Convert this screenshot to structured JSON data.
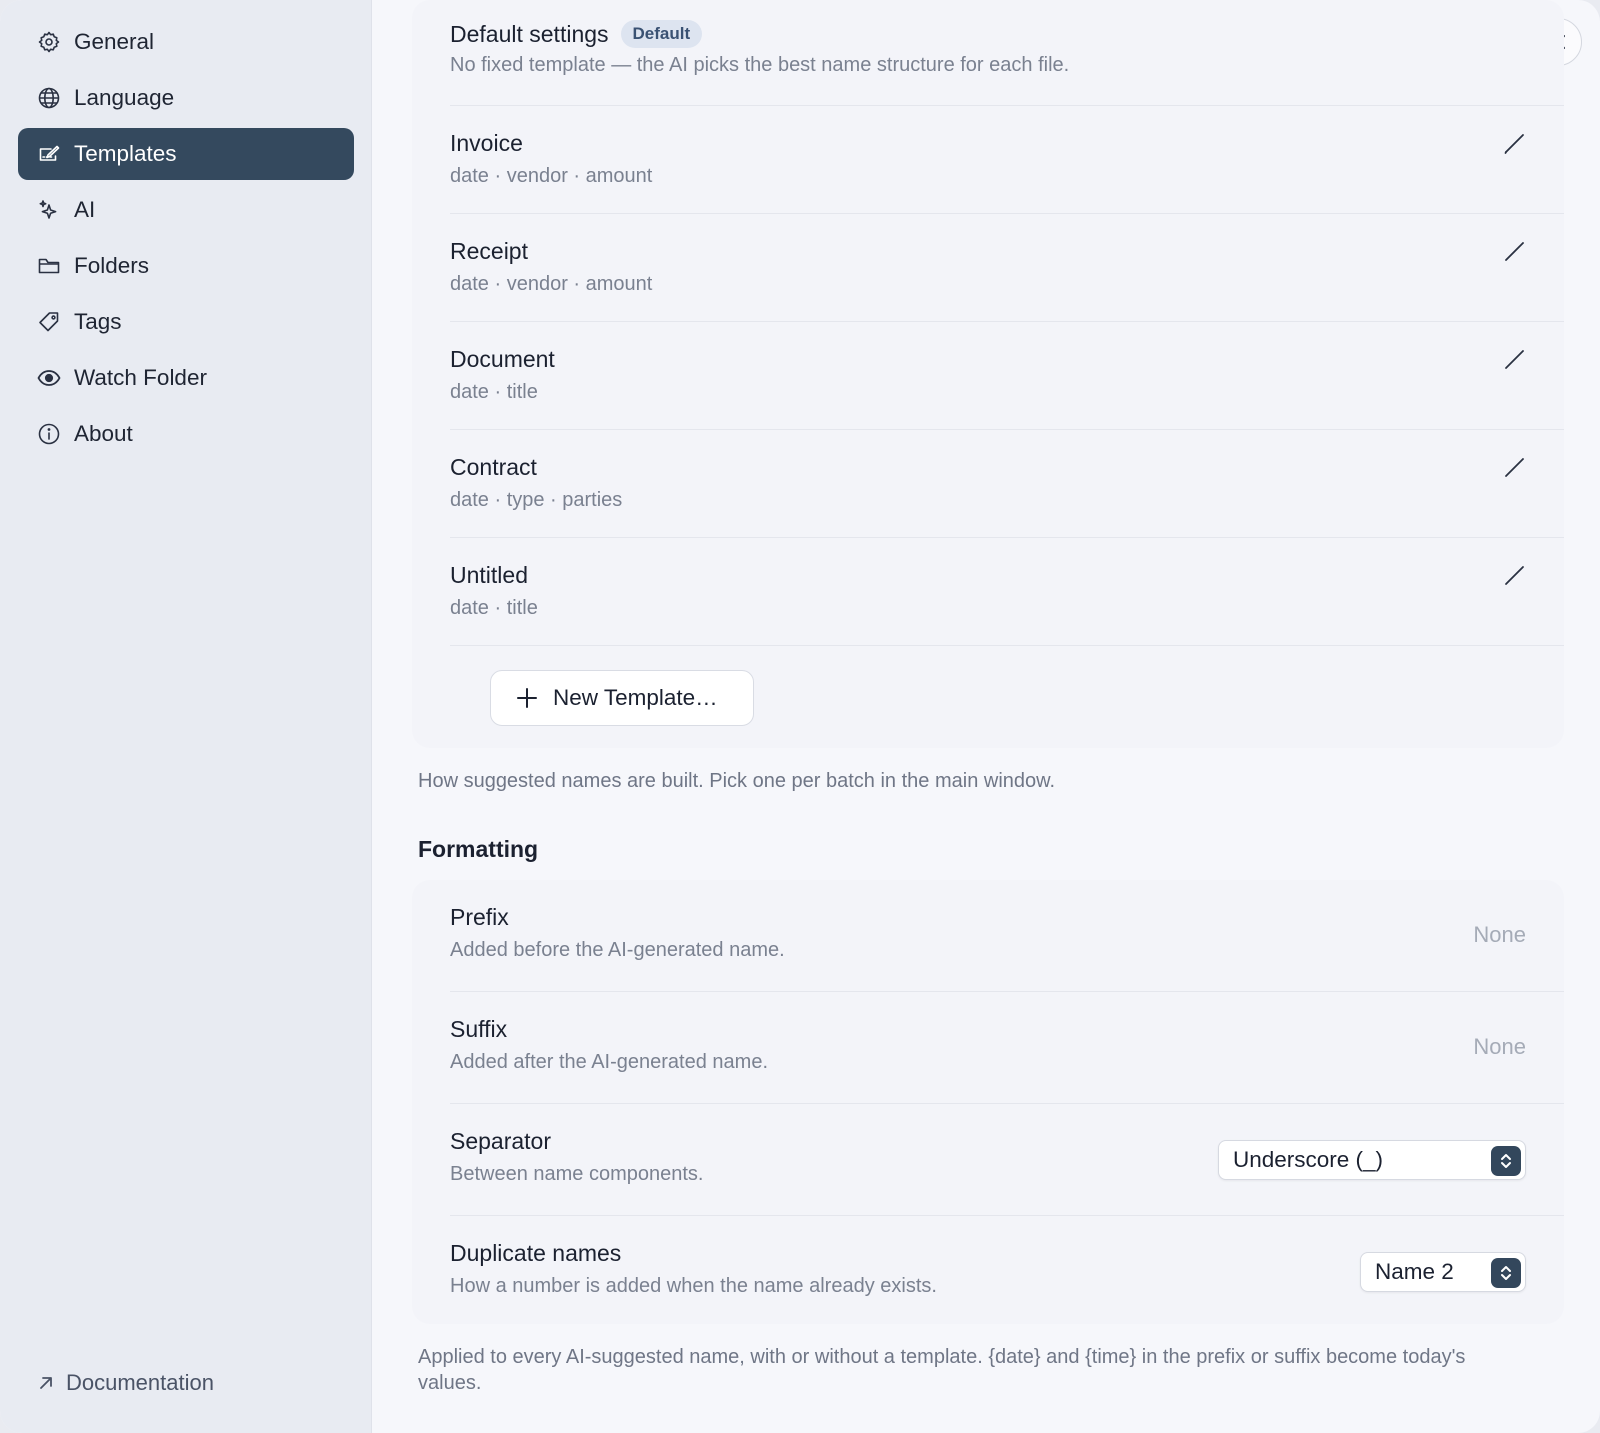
{
  "sidebar": {
    "items": [
      {
        "label": "General",
        "icon": "gear-icon"
      },
      {
        "label": "Language",
        "icon": "globe-icon"
      },
      {
        "label": "Templates",
        "icon": "templates-icon",
        "active": true
      },
      {
        "label": "AI",
        "icon": "sparkle-icon"
      },
      {
        "label": "Folders",
        "icon": "folder-icon"
      },
      {
        "label": "Tags",
        "icon": "tag-icon"
      },
      {
        "label": "Watch Folder",
        "icon": "eye-icon"
      },
      {
        "label": "About",
        "icon": "info-icon"
      }
    ],
    "documentation_label": "Documentation"
  },
  "templates": {
    "default": {
      "title": "Default settings",
      "badge": "Default",
      "description": "No fixed template — the AI picks the best name structure for each file."
    },
    "items": [
      {
        "name": "Invoice",
        "fields": "date · vendor · amount"
      },
      {
        "name": "Receipt",
        "fields": "date · vendor · amount"
      },
      {
        "name": "Document",
        "fields": "date · title"
      },
      {
        "name": "Contract",
        "fields": "date · type · parties"
      },
      {
        "name": "Untitled",
        "fields": "date · title"
      }
    ],
    "new_button_label": "New Template…",
    "caption": "How suggested names are built. Pick one per batch in the main window."
  },
  "formatting": {
    "section_title": "Formatting",
    "prefix": {
      "label": "Prefix",
      "description": "Added before the AI-generated name.",
      "placeholder": "None"
    },
    "suffix": {
      "label": "Suffix",
      "description": "Added after the AI-generated name.",
      "placeholder": "None"
    },
    "separator": {
      "label": "Separator",
      "description": "Between name components.",
      "value": "Underscore (_)"
    },
    "duplicates": {
      "label": "Duplicate names",
      "description": "How a number is added when the name already exists.",
      "value": "Name 2"
    },
    "caption": "Applied to every AI-suggested name, with or without a template. {date} and {time} in the prefix or suffix become today's values."
  },
  "colors": {
    "accent": "#34495e",
    "sidebar_bg": "#e8ebf2",
    "content_bg": "#f6f7fb"
  }
}
